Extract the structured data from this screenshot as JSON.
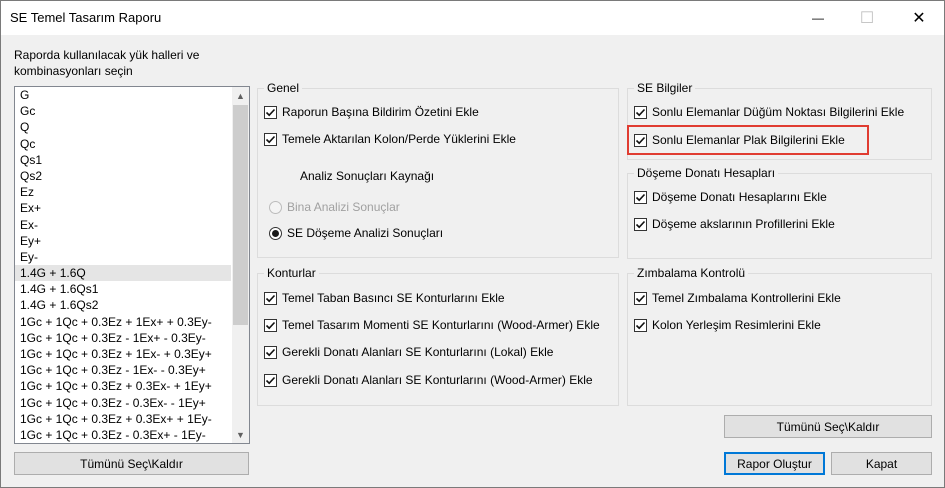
{
  "window": {
    "title": "SE Temel Tasarım Raporu",
    "controls": {
      "minimize": "—",
      "maximize": "☐",
      "close": "✕"
    }
  },
  "left": {
    "prompt": "Raporda kullanılacak yük halleri ve kombinasyonları seçin",
    "items": [
      "G",
      "Gc",
      "Q",
      "Qc",
      "Qs1",
      "Qs2",
      "Ez",
      "Ex+",
      "Ex-",
      "Ey+",
      "Ey-",
      "1.4G + 1.6Q",
      "1.4G + 1.6Qs1",
      "1.4G + 1.6Qs2",
      "1Gc + 1Qc + 0.3Ez + 1Ex+ + 0.3Ey-",
      "1Gc + 1Qc + 0.3Ez - 1Ex+ - 0.3Ey-",
      "1Gc + 1Qc + 0.3Ez + 1Ex- + 0.3Ey+",
      "1Gc + 1Qc + 0.3Ez - 1Ex- - 0.3Ey+",
      "1Gc + 1Qc + 0.3Ez + 0.3Ex- + 1Ey+",
      "1Gc + 1Qc + 0.3Ez - 0.3Ex- - 1Ey+",
      "1Gc + 1Qc + 0.3Ez + 0.3Ex+ + 1Ey-",
      "1Gc + 1Qc + 0.3Ez - 0.3Ex+ - 1Ey-"
    ],
    "selected_item": "1.4G + 1.6Q",
    "select_all_label": "Tümünü Seç\\Kaldır"
  },
  "genel": {
    "legend": "Genel",
    "cb1": "Raporun Başına Bildirim Özetini Ekle",
    "cb2": "Temele Aktarılan Kolon/Perde Yüklerini Ekle",
    "source_label": "Analiz Sonuçları Kaynağı",
    "radio1": "Bina Analizi Sonuçlar",
    "radio2": "SE Döşeme Analizi Sonuçları"
  },
  "konturlar": {
    "legend": "Konturlar",
    "cb1": "Temel Taban Basıncı SE Konturlarını Ekle",
    "cb2": "Temel Tasarım Momenti SE Konturlarını (Wood-Armer) Ekle",
    "cb3": "Gerekli Donatı Alanları SE Konturlarını (Lokal) Ekle",
    "cb4": "Gerekli Donatı Alanları SE Konturlarını (Wood-Armer) Ekle"
  },
  "se_bilgiler": {
    "legend": "SE Bilgiler",
    "cb1": "Sonlu Elemanlar Düğüm Noktası Bilgilerini Ekle",
    "cb2": "Sonlu Elemanlar Plak Bilgilerini Ekle"
  },
  "doseme": {
    "legend": "Döşeme Donatı Hesapları",
    "cb1": "Döşeme Donatı Hesaplarını Ekle",
    "cb2": "Döşeme akslarının Profillerini Ekle"
  },
  "zimbalama": {
    "legend": "Zımbalama Kontrolü",
    "cb1": "Temel Zımbalama Kontrollerini Ekle",
    "cb2": "Kolon Yerleşim Resimlerini Ekle"
  },
  "buttons": {
    "select_all_right": "Tümünü Seç\\Kaldır",
    "create_report": "Rapor Oluştur",
    "close": "Kapat"
  },
  "colors": {
    "highlight": "#e03c31",
    "default_button_border": "#0078d7"
  }
}
